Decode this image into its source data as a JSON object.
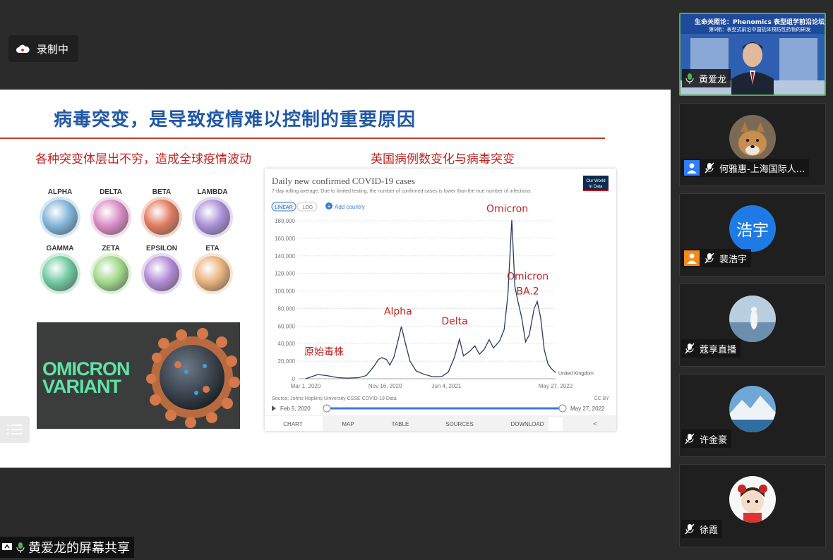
{
  "recording": {
    "label": "录制中"
  },
  "slide": {
    "title": "病毒突变，是导致疫情难以控制的重要原因",
    "left_subtitle": "各种突变体层出不穷，造成全球疫情波动",
    "right_subtitle": "英国病例数变化与病毒突变",
    "variants": [
      {
        "name": "ALPHA",
        "color": "#7fb3d9"
      },
      {
        "name": "DELTA",
        "color": "#d88cc4"
      },
      {
        "name": "BETA",
        "color": "#e07a5f"
      },
      {
        "name": "LAMBDA",
        "color": "#a98fd8"
      },
      {
        "name": "GAMMA",
        "color": "#6fc9a0"
      },
      {
        "name": "ZETA",
        "color": "#9fd88a"
      },
      {
        "name": "EPSILON",
        "color": "#b28ad6"
      },
      {
        "name": "ETA",
        "color": "#e8b07a"
      }
    ],
    "omicron_variant_text": [
      "OMICRON",
      "VARIANT"
    ]
  },
  "chart_data": {
    "type": "line",
    "title": "Daily new confirmed COVID-19 cases",
    "subtitle": "7-day rolling average. Due to limited testing, the number of confirmed cases is lower than the true number of infections.",
    "logo": [
      "Our World",
      "in Data"
    ],
    "scale_buttons": [
      "LINEAR",
      "LOG"
    ],
    "add_country": "Add country",
    "y_ticks": [
      "180,000",
      "160,000",
      "140,000",
      "120,000",
      "100,000",
      "80,000",
      "60,000",
      "40,000",
      "20,000",
      "0"
    ],
    "ylim": [
      0,
      180000
    ],
    "x_ticks": [
      "Mar 1, 2020",
      "Nov 16, 2020",
      "Jun 4, 2021",
      "May 27, 2022"
    ],
    "series_label": "United Kingdom",
    "series": [
      {
        "name": "United Kingdom",
        "color": "#2a3a5e",
        "points": [
          [
            "2020-03-01",
            0
          ],
          [
            "2020-04-10",
            4800
          ],
          [
            "2020-05-10",
            3500
          ],
          [
            "2020-06-15",
            1200
          ],
          [
            "2020-07-15",
            700
          ],
          [
            "2020-08-20",
            1200
          ],
          [
            "2020-09-15",
            3500
          ],
          [
            "2020-10-10",
            14000
          ],
          [
            "2020-10-25",
            22000
          ],
          [
            "2020-11-05",
            24000
          ],
          [
            "2020-11-20",
            22000
          ],
          [
            "2020-12-01",
            15500
          ],
          [
            "2020-12-15",
            25000
          ],
          [
            "2020-12-29",
            45000
          ],
          [
            "2021-01-08",
            59500
          ],
          [
            "2021-01-20",
            42000
          ],
          [
            "2021-02-05",
            20000
          ],
          [
            "2021-02-25",
            9000
          ],
          [
            "2021-03-20",
            5500
          ],
          [
            "2021-04-20",
            2300
          ],
          [
            "2021-05-20",
            2500
          ],
          [
            "2021-06-10",
            7500
          ],
          [
            "2021-06-30",
            24000
          ],
          [
            "2021-07-17",
            45000
          ],
          [
            "2021-07-30",
            26000
          ],
          [
            "2021-08-20",
            31500
          ],
          [
            "2021-09-05",
            37500
          ],
          [
            "2021-09-20",
            28000
          ],
          [
            "2021-10-05",
            33000
          ],
          [
            "2021-10-22",
            44500
          ],
          [
            "2021-11-05",
            35000
          ],
          [
            "2021-11-25",
            43000
          ],
          [
            "2021-12-10",
            56000
          ],
          [
            "2021-12-22",
            95000
          ],
          [
            "2022-01-04",
            181000
          ],
          [
            "2022-01-14",
            105000
          ],
          [
            "2022-01-24",
            88000
          ],
          [
            "2022-02-05",
            70000
          ],
          [
            "2022-02-18",
            42000
          ],
          [
            "2022-03-02",
            50000
          ],
          [
            "2022-03-18",
            80000
          ],
          [
            "2022-03-28",
            88000
          ],
          [
            "2022-04-08",
            70000
          ],
          [
            "2022-04-20",
            33000
          ],
          [
            "2022-05-02",
            17000
          ],
          [
            "2022-05-12",
            12000
          ],
          [
            "2022-05-27",
            7000
          ]
        ]
      }
    ],
    "annotations": [
      {
        "text": "原始毒株",
        "date": "2020-04-30",
        "value": 27000
      },
      {
        "text": "Alpha",
        "date": "2020-12-28",
        "value": 73000
      },
      {
        "text": "Delta",
        "date": "2021-07-01",
        "value": 62000
      },
      {
        "text": "Omicron",
        "date": "2021-12-20",
        "value": 190000
      },
      {
        "text": "Omicron",
        "date": "2022-02-25",
        "value": 113000
      },
      {
        "text": "BA.2",
        "date": "2022-02-25",
        "value": 96000
      }
    ],
    "source": "Source: Johns Hopkins University CSSE COVID-19 Data",
    "license": "CC BY",
    "timeline": {
      "start": "Feb 5, 2020",
      "end": "May 27, 2022"
    },
    "tabs": [
      "CHART",
      "MAP",
      "TABLE",
      "SOURCES",
      "DOWNLOAD"
    ],
    "colors": {
      "axis_text": "#777777",
      "grid": "#dddddd",
      "slider": "#3a7dd8",
      "annotation": "#c0221f"
    }
  },
  "participants": [
    {
      "name": "黄爱龙",
      "mic": "on",
      "active": true,
      "banner": "生命关照论：Phenomics 表型组学前沿论坛",
      "banner_sub": "第9期：表型式前沿中国抗体预防性药物的研发"
    },
    {
      "name": "何雅惠-上海国际人...",
      "mic": "muted",
      "user_icon": "person-blue"
    },
    {
      "name": "裴浩宇",
      "mic": "muted",
      "user_icon": "person-orange",
      "initials": "浩宇"
    },
    {
      "name": "蔻享直播",
      "mic": "muted"
    },
    {
      "name": "许金豪",
      "mic": "muted"
    },
    {
      "name": "徐霞",
      "mic": "muted"
    }
  ],
  "share_label": "黄爱龙的屏幕共享",
  "colors": {
    "accent_green": "#4caf50",
    "title_blue": "#2158a6",
    "red": "#c0221f"
  }
}
